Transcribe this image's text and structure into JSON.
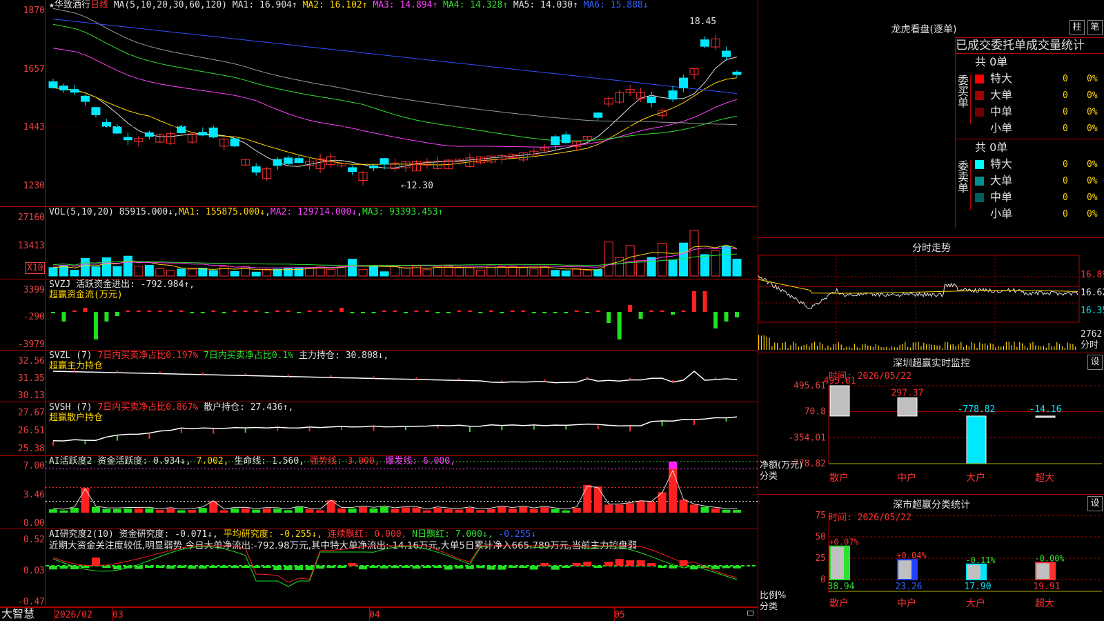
{
  "stock": {
    "star": "★",
    "name": "华致酒行",
    "period": "日线",
    "ma_param": "MA(5,10,20,30,60,120)",
    "ma1": "MA1: 16.904↑",
    "ma2": "MA2: 16.102↑",
    "ma3": "MA3: 14.894↑",
    "ma4": "MA4: 14.328↑",
    "ma5": "MA5: 14.030↑",
    "ma6": "MA6: 15.888↓",
    "high_label": "18.45",
    "low_label": "←12.30",
    "y_ticks": [
      "1870",
      "1657",
      "1443",
      "1230"
    ]
  },
  "vol": {
    "param": "VOL(5,10,20)",
    "val": "85915.000↓",
    "ma1": "MA1: 155875.000↓",
    "ma2": "MA2: 129714.000↓",
    "ma3": "MA3: 93393.453↑",
    "y_ticks": [
      "27160",
      "13413"
    ],
    "unit": "X10"
  },
  "svzj": {
    "name": "SVZJ",
    "line1": "活跃资金进出: -792.984↑,",
    "line2": "超赢资金流(万元)",
    "y_ticks": [
      "3399",
      "-290",
      "-3979"
    ]
  },
  "svzl": {
    "name": "SVZL (7)",
    "p1": "7日内买卖净占比0.197%",
    "p2": "7日内买卖净占比0.1%",
    "p3": "主力持仓: 30.808↓,",
    "line2": "超赢主力持仓",
    "y_ticks": [
      "32.56",
      "31.35",
      "30.13"
    ]
  },
  "svsh": {
    "name": "SVSH (7)",
    "p1": "7日内买卖净占比0.867%",
    "p2": "散户持仓: 27.436↑,",
    "line2": "超赢散户持仓",
    "y_ticks": [
      "27.67",
      "26.51",
      "25.38"
    ]
  },
  "ai1": {
    "name": "AI活跃度2",
    "p1": "资金活跃度: 0.934↓,",
    "p2": "7.002,",
    "p3": "生命线: 1.560,",
    "p4": "强势线: 3.000,",
    "p5": "爆发线: 6.000,",
    "y_ticks": [
      "7.00",
      "3.46",
      "0.00"
    ]
  },
  "ai2": {
    "name": "AI研究度2(10)",
    "p1": "资金研究度: -0.071↓,",
    "p2": "平均研究度: -0.255↓,",
    "p3": "连续飘红: 0.000,",
    "p4": "N日飘红: 7.000↓,",
    "p5": "-0.255↓",
    "comment": "近期大资金关注度较低,明显弱势,今日大单净流出:-792.98万元,其中特大单净流出:-14.16万元,大单5日累计净入665.789万元,当前主力控盘弱",
    "y_ticks": [
      "0.52",
      "0.03",
      "-0.47"
    ]
  },
  "bottom": {
    "brand": "大智慧",
    "dates": [
      "2026/02",
      "03",
      "04",
      "05"
    ]
  },
  "lhb": {
    "title": "龙虎看盘(逐单)",
    "btn1": "柱",
    "btn2": "笔",
    "tabs": [
      "已成交",
      "委托单",
      "成交量统计"
    ],
    "buy": {
      "side": "委买单",
      "total": "共 0单",
      "rows": [
        {
          "name": "特大",
          "count": "0",
          "pct": "0%",
          "color": "#ff0000"
        },
        {
          "name": "大单",
          "count": "0",
          "pct": "0%",
          "color": "#a00000"
        },
        {
          "name": "中单",
          "count": "0",
          "pct": "0%",
          "color": "#700000"
        },
        {
          "name": "小单",
          "count": "0",
          "pct": "0%",
          "color": "#000000"
        }
      ]
    },
    "sell": {
      "side": "委卖单",
      "total": "共 0单",
      "rows": [
        {
          "name": "特大",
          "count": "0",
          "pct": "0%",
          "color": "#00ffff"
        },
        {
          "name": "大单",
          "count": "0",
          "pct": "0%",
          "color": "#009090"
        },
        {
          "name": "中单",
          "count": "0",
          "pct": "0%",
          "color": "#006060"
        },
        {
          "name": "小单",
          "count": "0",
          "pct": "0%",
          "color": "#000000"
        }
      ]
    }
  },
  "intraday": {
    "title": "分时走势",
    "prices": [
      "16.89",
      "16.62",
      "16.35"
    ],
    "vol": "2762",
    "vol_unit": "分时"
  },
  "sz_monitor": {
    "title": "深圳超赢实时监控",
    "btn": "设",
    "time": "时间: 2026/05/22",
    "y_ticks": [
      "495.61",
      "70.8",
      "-354.01",
      "-778.82"
    ],
    "ylabel1": "净额(万元)",
    "ylabel2": "分类",
    "chart_data": {
      "type": "bar",
      "categories": [
        "散户",
        "中户",
        "大户",
        "超大"
      ],
      "values": [
        495.61,
        297.37,
        -778.82,
        -14.16
      ],
      "ylim": [
        -778.82,
        495.61
      ]
    }
  },
  "sz_class": {
    "title": "深市超赢分类统计",
    "btn": "设",
    "time": "时间: 2026/05/22",
    "y_ticks": [
      "75",
      "50",
      "25",
      "0"
    ],
    "ylabel1": "比例%",
    "ylabel2": "分类",
    "chart_data": {
      "type": "bar",
      "categories": [
        "散户",
        "中户",
        "大户",
        "超大"
      ],
      "values": [
        38.94,
        23.26,
        17.9,
        19.91
      ],
      "changes": [
        "+0.07%",
        "+0.04%",
        "-0.11%",
        "-0.00%"
      ],
      "ylim": [
        0,
        75
      ]
    }
  }
}
